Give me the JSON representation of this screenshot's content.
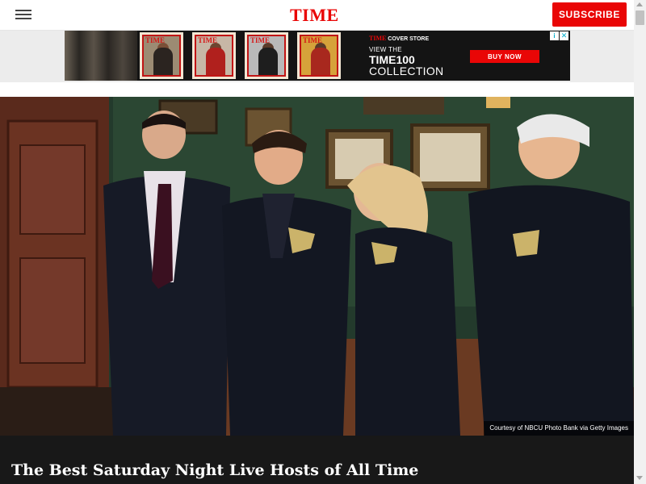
{
  "header": {
    "menu_icon": "hamburger-menu-icon",
    "logo": "TIME",
    "subscribe_label": "SUBSCRIBE",
    "brand_color": "#e90606"
  },
  "ad": {
    "cover_store_brand": "TIME",
    "cover_store_label": "COVER STORE",
    "view_the": "VIEW THE",
    "time100": "TIME100",
    "collection": "COLLECTION",
    "buy_label": "BUY NOW",
    "info_icon": "ad-info-icon",
    "close_icon": "ad-close-icon",
    "cover_mastheads": [
      "TIME",
      "TIME",
      "TIME",
      "TIME"
    ]
  },
  "hero": {
    "credit": "Courtesy of NBCU Photo Bank via Getty Images"
  },
  "article": {
    "title": "The Best Saturday Night Live Hosts of All Time"
  }
}
